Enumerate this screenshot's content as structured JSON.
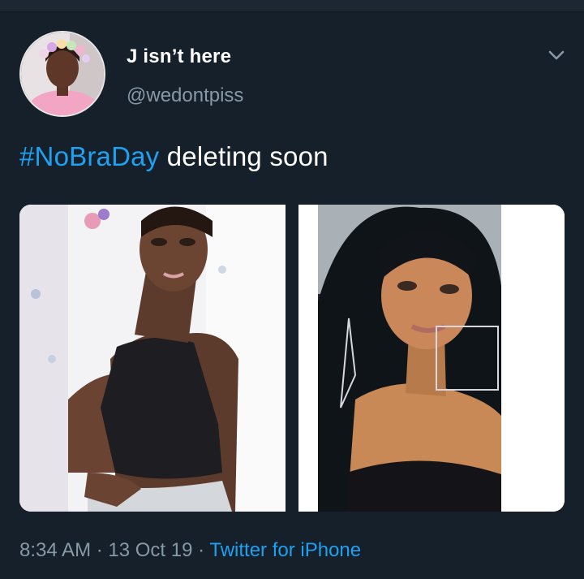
{
  "tweet": {
    "author": {
      "display_name": "J isn’t here",
      "handle": "@wedontpiss"
    },
    "text": {
      "hashtag": "#NoBraDay",
      "body": " deleting soon"
    },
    "meta": {
      "time": "8:34 AM",
      "separator": " · ",
      "date": "13 Oct 19",
      "source": "Twitter for iPhone"
    }
  },
  "icons": {
    "more": "chevron-down-icon"
  },
  "colors": {
    "background": "#15202b",
    "accent": "#1da1f2",
    "secondary_text": "#8899a6"
  }
}
